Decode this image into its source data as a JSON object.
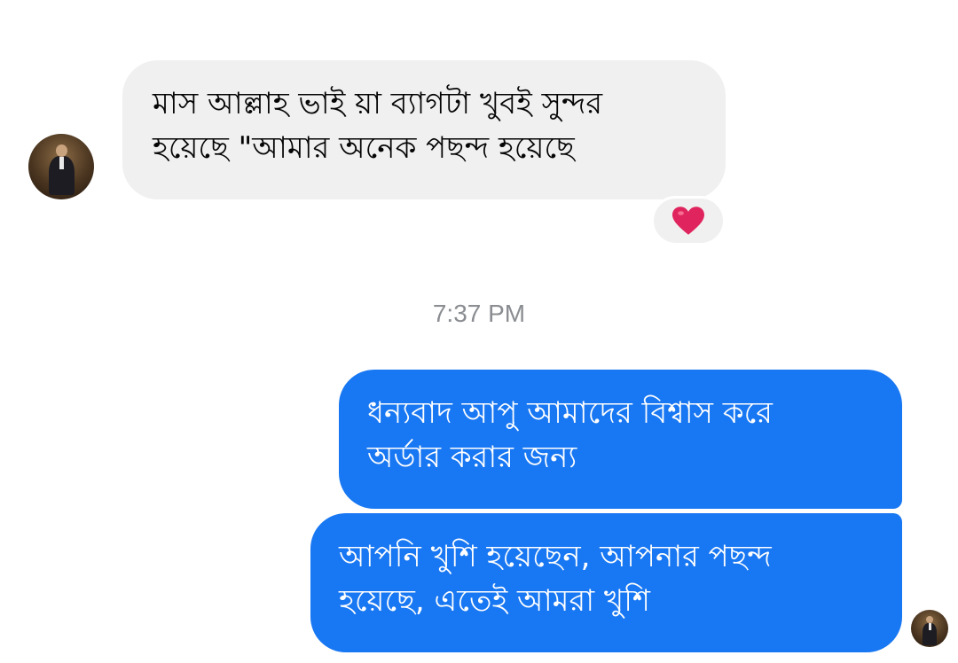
{
  "messages": {
    "incoming": {
      "lines": [
        "মাস আল্লাহ ভাই য়া ব্যাগটা খুবই সুন্দর",
        "হয়েছে \"আমার অনেক পছন্দ হয়েছে"
      ],
      "reaction_icon": "heart-icon",
      "reaction_color": "#e0245e"
    },
    "timestamp": "7:37 PM",
    "outgoing": [
      {
        "lines": [
          "ধন্যবাদ আপু আমাদের বিশ্বাস করে",
          "অর্ডার করার জন্য"
        ]
      },
      {
        "lines": [
          "আপনি খুশি হয়েছেন, আপনার পছন্দ",
          "হয়েছে, এতেই আমরা খুশি"
        ]
      }
    ]
  },
  "colors": {
    "outgoing_bubble": "#1877f2",
    "incoming_bubble": "#f0f0f0",
    "timestamp_text": "#8a8d91"
  }
}
